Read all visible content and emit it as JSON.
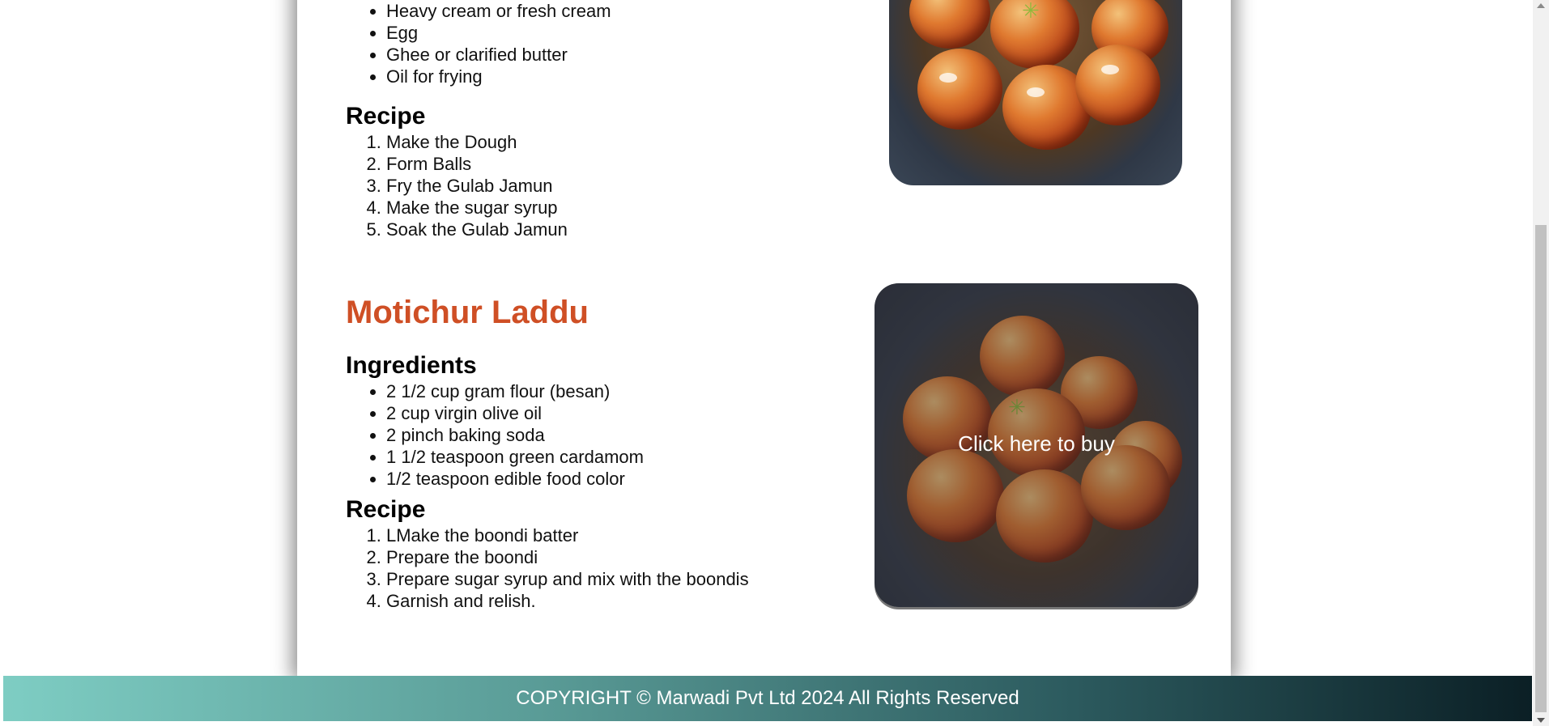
{
  "sections": {
    "gulab": {
      "ingredients_tail": [
        "Heavy cream or fresh cream",
        "Egg",
        "Ghee or clarified butter",
        "Oil for frying"
      ],
      "recipe_heading": "Recipe",
      "recipe": [
        "Make the Dough",
        "Form Balls",
        "Fry the Gulab Jamun",
        "Make the sugar syrup",
        "Soak the Gulab Jamun"
      ]
    },
    "laddu": {
      "title": "Motichur Laddu",
      "ingredients_heading": "Ingredients",
      "ingredients": [
        "2 1/2 cup gram flour (besan)",
        "2 cup virgin olive oil",
        "2 pinch baking soda",
        "1 1/2 teaspoon green cardamom",
        "1/2 teaspoon edible food color"
      ],
      "recipe_heading": "Recipe",
      "recipe": [
        "LMake the boondi batter",
        "Prepare the boondi",
        "Prepare sugar syrup and mix with the boondis",
        "Garnish and relish."
      ],
      "buy_label": "Click here to buy"
    }
  },
  "footer": {
    "text": "COPYRIGHT © Marwadi Pvt Ltd 2024 All Rights Reserved"
  },
  "colors": {
    "title": "#cf4f25",
    "footer_start": "#7ecdc3",
    "footer_end": "#0b1f25"
  }
}
